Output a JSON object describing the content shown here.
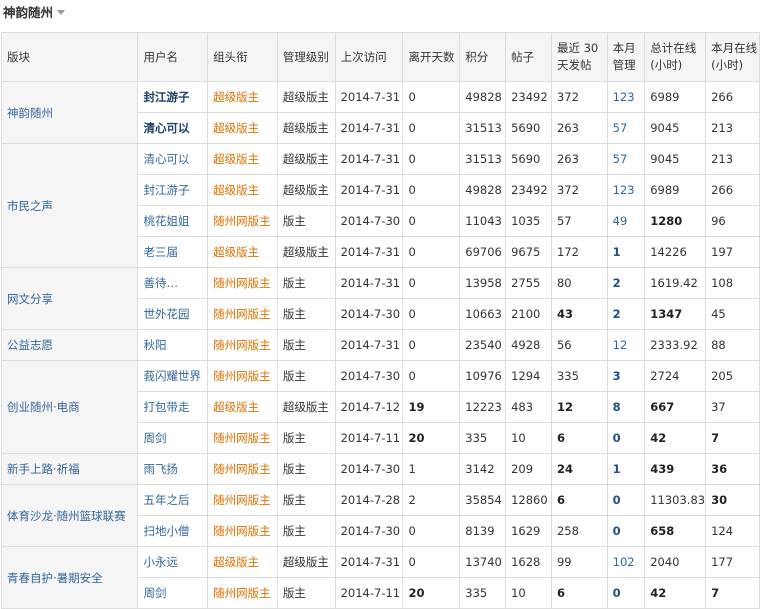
{
  "header": {
    "title": "神韵随州"
  },
  "columns": [
    "版块",
    "用户名",
    "组头衔",
    "管理级别",
    "上次访问",
    "离开天数",
    "积分",
    "帖子",
    "最近 30 天发帖",
    "本月管理",
    "总计在线(小时)",
    "本月在线(小时)"
  ],
  "groups": [
    {
      "block": "神韵随州",
      "rows": [
        {
          "user": "封江游子",
          "title": "超级版主",
          "level": "超级版主",
          "last": "2014-7-31",
          "days": "0",
          "points": "49828",
          "posts": "23492",
          "recent": "372",
          "manage": "123",
          "total": "6989",
          "month": "266"
        },
        {
          "user": "清心可以",
          "title": "超级版主",
          "level": "超级版主",
          "last": "2014-7-31",
          "days": "0",
          "points": "31513",
          "posts": "5690",
          "recent": "263",
          "manage": "57",
          "total": "9045",
          "month": "213"
        }
      ]
    },
    {
      "block": "市民之声",
      "rows": [
        {
          "user": "清心可以",
          "title": "超级版主",
          "level": "超级版主",
          "last": "2014-7-31",
          "days": "0",
          "points": "31513",
          "posts": "5690",
          "recent": "263",
          "manage": "57",
          "total": "9045",
          "month": "213"
        },
        {
          "user": "封江游子",
          "title": "超级版主",
          "level": "超级版主",
          "last": "2014-7-31",
          "days": "0",
          "points": "49828",
          "posts": "23492",
          "recent": "372",
          "manage": "123",
          "total": "6989",
          "month": "266"
        },
        {
          "user": "桃花姐姐",
          "title": "随州网版主",
          "level": "版主",
          "last": "2014-7-30",
          "days": "0",
          "points": "11043",
          "posts": "1035",
          "recent": "57",
          "manage": "49",
          "total": "1280",
          "month": "96"
        },
        {
          "user": "老三届",
          "title": "超级版主",
          "level": "超级版主",
          "last": "2014-7-31",
          "days": "0",
          "points": "69706",
          "posts": "9675",
          "recent": "172",
          "manage": "1",
          "total": "14226",
          "month": "197"
        }
      ]
    },
    {
      "block": "网文分享",
      "rows": [
        {
          "user": "善待…",
          "title": "随州网版主",
          "level": "版主",
          "last": "2014-7-31",
          "days": "0",
          "points": "13958",
          "posts": "2755",
          "recent": "80",
          "manage": "2",
          "total": "1619.42",
          "month": "108"
        },
        {
          "user": "世外花园",
          "title": "随州网版主",
          "level": "版主",
          "last": "2014-7-30",
          "days": "0",
          "points": "10663",
          "posts": "2100",
          "recent": "43",
          "manage": "2",
          "total": "1347",
          "month": "45"
        }
      ]
    },
    {
      "block": "公益志愿",
      "rows": [
        {
          "user": "秋阳",
          "title": "随州网版主",
          "level": "版主",
          "last": "2014-7-31",
          "days": "0",
          "points": "23540",
          "posts": "4928",
          "recent": "56",
          "manage": "12",
          "total": "2333.92",
          "month": "88"
        }
      ]
    },
    {
      "block": "创业随州·电商",
      "rows": [
        {
          "user": "莪闪耀世界",
          "title": "随州网版主",
          "level": "版主",
          "last": "2014-7-30",
          "days": "0",
          "points": "10976",
          "posts": "1294",
          "recent": "335",
          "manage": "3",
          "total": "2724",
          "month": "205"
        },
        {
          "user": "打包带走",
          "title": "超级版主",
          "level": "超级版主",
          "last": "2014-7-12",
          "days": "19",
          "points": "12223",
          "posts": "483",
          "recent": "12",
          "manage": "8",
          "total": "667",
          "month": "37"
        },
        {
          "user": "周剑",
          "title": "随州网版主",
          "level": "版主",
          "last": "2014-7-11",
          "days": "20",
          "points": "335",
          "posts": "10",
          "recent": "6",
          "manage": "0",
          "total": "42",
          "month": "7"
        }
      ]
    },
    {
      "block": "新手上路·祈福",
      "rows": [
        {
          "user": "雨飞扬",
          "title": "随州网版主",
          "level": "版主",
          "last": "2014-7-30",
          "days": "1",
          "points": "3142",
          "posts": "209",
          "recent": "24",
          "manage": "1",
          "total": "439",
          "month": "36"
        }
      ]
    },
    {
      "block": "体育沙龙·随州篮球联赛",
      "rows": [
        {
          "user": "五年之后",
          "title": "随州网版主",
          "level": "版主",
          "last": "2014-7-28",
          "days": "2",
          "points": "35854",
          "posts": "12860",
          "recent": "6",
          "manage": "0",
          "total": "11303.83",
          "month": "30"
        },
        {
          "user": "扫地小僧",
          "title": "随州网版主",
          "level": "版主",
          "last": "2014-7-30",
          "days": "0",
          "points": "8139",
          "posts": "1629",
          "recent": "258",
          "manage": "0",
          "total": "658",
          "month": "124"
        }
      ]
    },
    {
      "block": "青春自护·暑期安全",
      "rows": [
        {
          "user": "小永远",
          "title": "超级版主",
          "level": "超级版主",
          "last": "2014-7-31",
          "days": "0",
          "points": "13740",
          "posts": "1628",
          "recent": "99",
          "manage": "102",
          "total": "2040",
          "month": "177"
        },
        {
          "user": "周剑",
          "title": "随州网版主",
          "level": "版主",
          "last": "2014-7-11",
          "days": "20",
          "points": "335",
          "posts": "10",
          "recent": "6",
          "manage": "0",
          "total": "42",
          "month": "7"
        }
      ]
    }
  ]
}
